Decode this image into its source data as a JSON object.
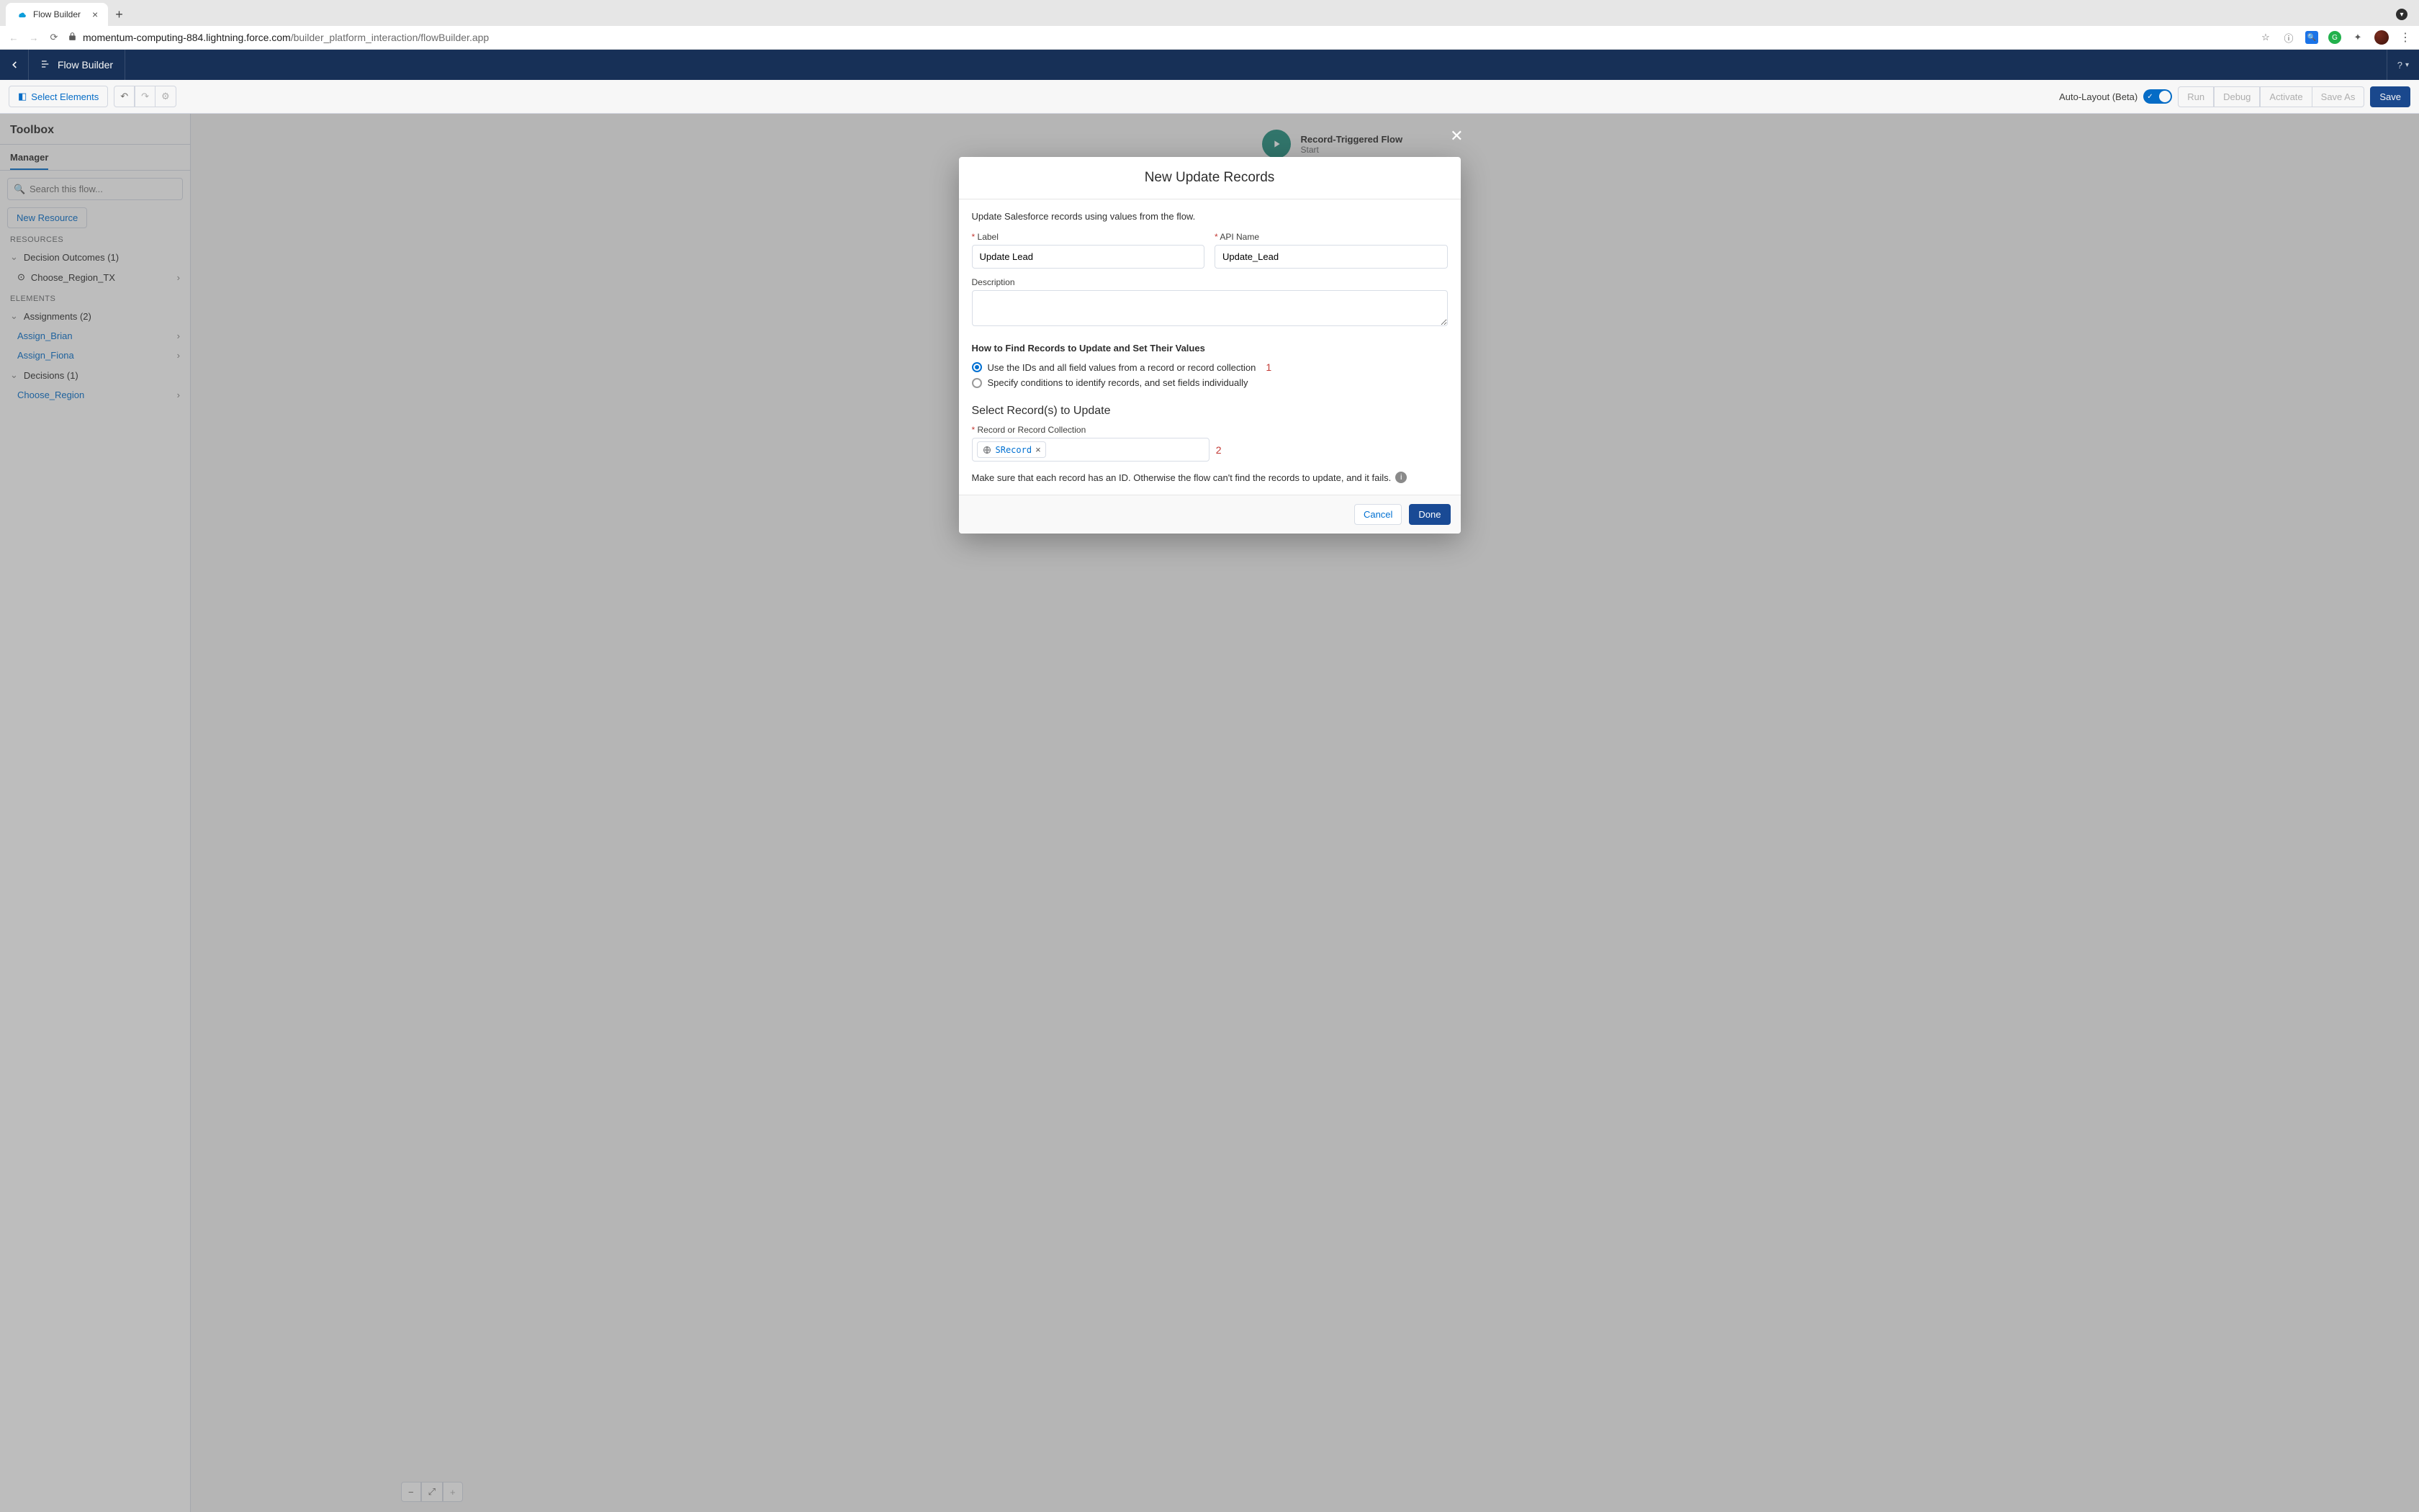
{
  "browser": {
    "tab_title": "Flow Builder",
    "url_host": "momentum-computing-884.lightning.force.com",
    "url_path": "/builder_platform_interaction/flowBuilder.app"
  },
  "app_header": {
    "back_aria": "Back",
    "brand": "Flow Builder",
    "help_label": "?"
  },
  "toolbar": {
    "select_elements": "Select Elements",
    "auto_layout": "Auto-Layout (Beta)",
    "run": "Run",
    "debug": "Debug",
    "activate": "Activate",
    "save_as": "Save As",
    "save": "Save"
  },
  "sidebar": {
    "title": "Toolbox",
    "tab_manager": "Manager",
    "search_placeholder": "Search this flow...",
    "new_resource": "New Resource",
    "section_resources": "RESOURCES",
    "decision_outcomes_label": "Decision Outcomes (1)",
    "decision_outcome_item": "Choose_Region_TX",
    "section_elements": "ELEMENTS",
    "assignments_label": "Assignments (2)",
    "assign_items": [
      "Assign_Brian",
      "Assign_Fiona"
    ],
    "decisions_label": "Decisions (1)",
    "decisions_item": "Choose_Region"
  },
  "canvas": {
    "start_title": "Record-Triggered Flow",
    "start_sub": "Start"
  },
  "modal": {
    "title": "New Update Records",
    "intro": "Update Salesforce records using values from the flow.",
    "label_label": "Label",
    "label_value": "Update Lead",
    "api_label": "API Name",
    "api_value": "Update_Lead",
    "desc_label": "Description",
    "desc_value": "",
    "how_title": "How to Find Records to Update and Set Their Values",
    "radio1": "Use the IDs and all field values from a record or record collection",
    "radio2": "Specify conditions to identify records, and set fields individually",
    "annot1": "1",
    "select_title": "Select Record(s) to Update",
    "rec_label": "Record or Record Collection",
    "pill_value": "SRecord",
    "annot2": "2",
    "hint": "Make sure that each record has an ID. Otherwise the flow can't find the records to update, and it fails.",
    "cancel": "Cancel",
    "done": "Done"
  }
}
